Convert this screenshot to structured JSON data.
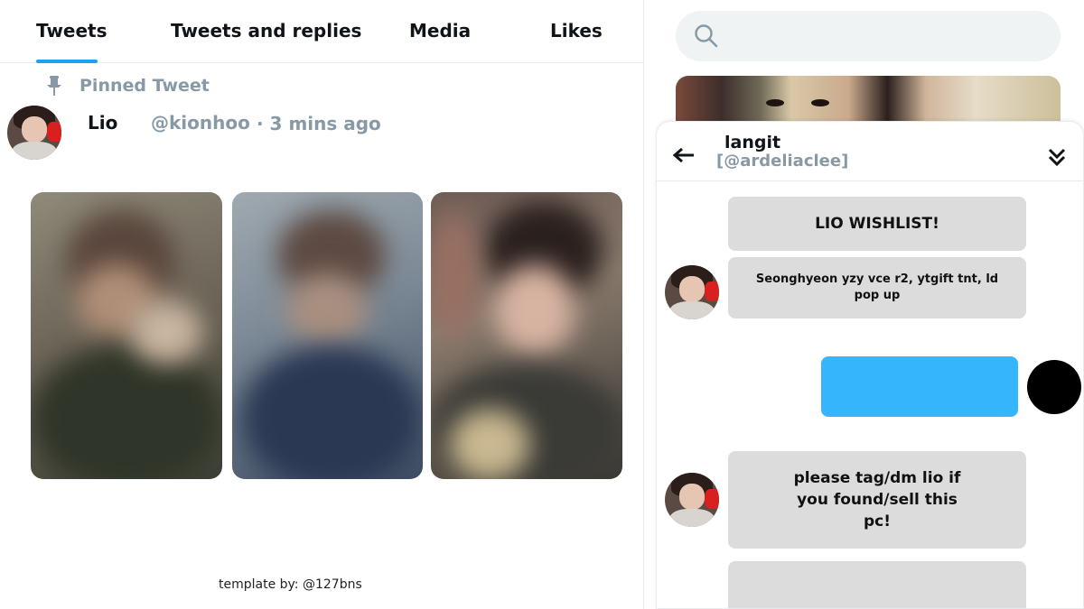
{
  "tabs": [
    {
      "label": "Tweets",
      "active": true
    },
    {
      "label": "Tweets and replies",
      "active": false
    },
    {
      "label": "Media",
      "active": false
    },
    {
      "label": "Likes",
      "active": false
    }
  ],
  "pinned": {
    "label": "Pinned Tweet",
    "icon": "pin-icon"
  },
  "tweet": {
    "name": "Lio",
    "handle": "@kionhoo",
    "time": "· 3 mins ago",
    "photos_count": 3
  },
  "credit": "template by: @127bns",
  "search": {
    "placeholder": "",
    "icon": "search-icon"
  },
  "dm": {
    "name": "langit",
    "handle": "[@ardeliaclee]",
    "messages": [
      {
        "text": "LIO WISHLIST!"
      },
      {
        "text": "Seonghyeon yzy vce r2, ytgift tnt, ld pop up"
      },
      {
        "text": "please tag/dm lio if you found/sell this pc!"
      },
      {
        "text": ""
      }
    ]
  },
  "colors": {
    "accent": "#1da1f2",
    "muted": "#8899a6",
    "bubble_gray": "#dcdcdc",
    "bubble_blue": "#35b5fb"
  }
}
